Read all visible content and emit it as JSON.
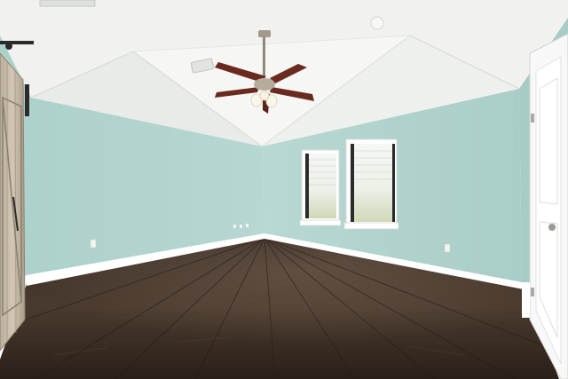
{
  "scene": {
    "kind": "photo",
    "subject": "empty-room-interior"
  },
  "colors": {
    "wall": "#b4d6d1",
    "wall_shadow": "#a9cec8",
    "ceiling": "#f2f3f1",
    "ceiling_shadow": "#e4e6e3",
    "floor_dark": "#2f241d",
    "floor_mid": "#4a3a2e",
    "baseboard": "#ffffff",
    "door": "#ffffff",
    "barn_door": "#c9bca9",
    "fan_blade": "#6b2a1f",
    "fan_metal": "#a39a8c"
  },
  "fixtures": {
    "ceiling_fan": {
      "blades": 5,
      "light_kit": true
    },
    "windows": 2,
    "barn_door": true,
    "interior_door": true
  }
}
